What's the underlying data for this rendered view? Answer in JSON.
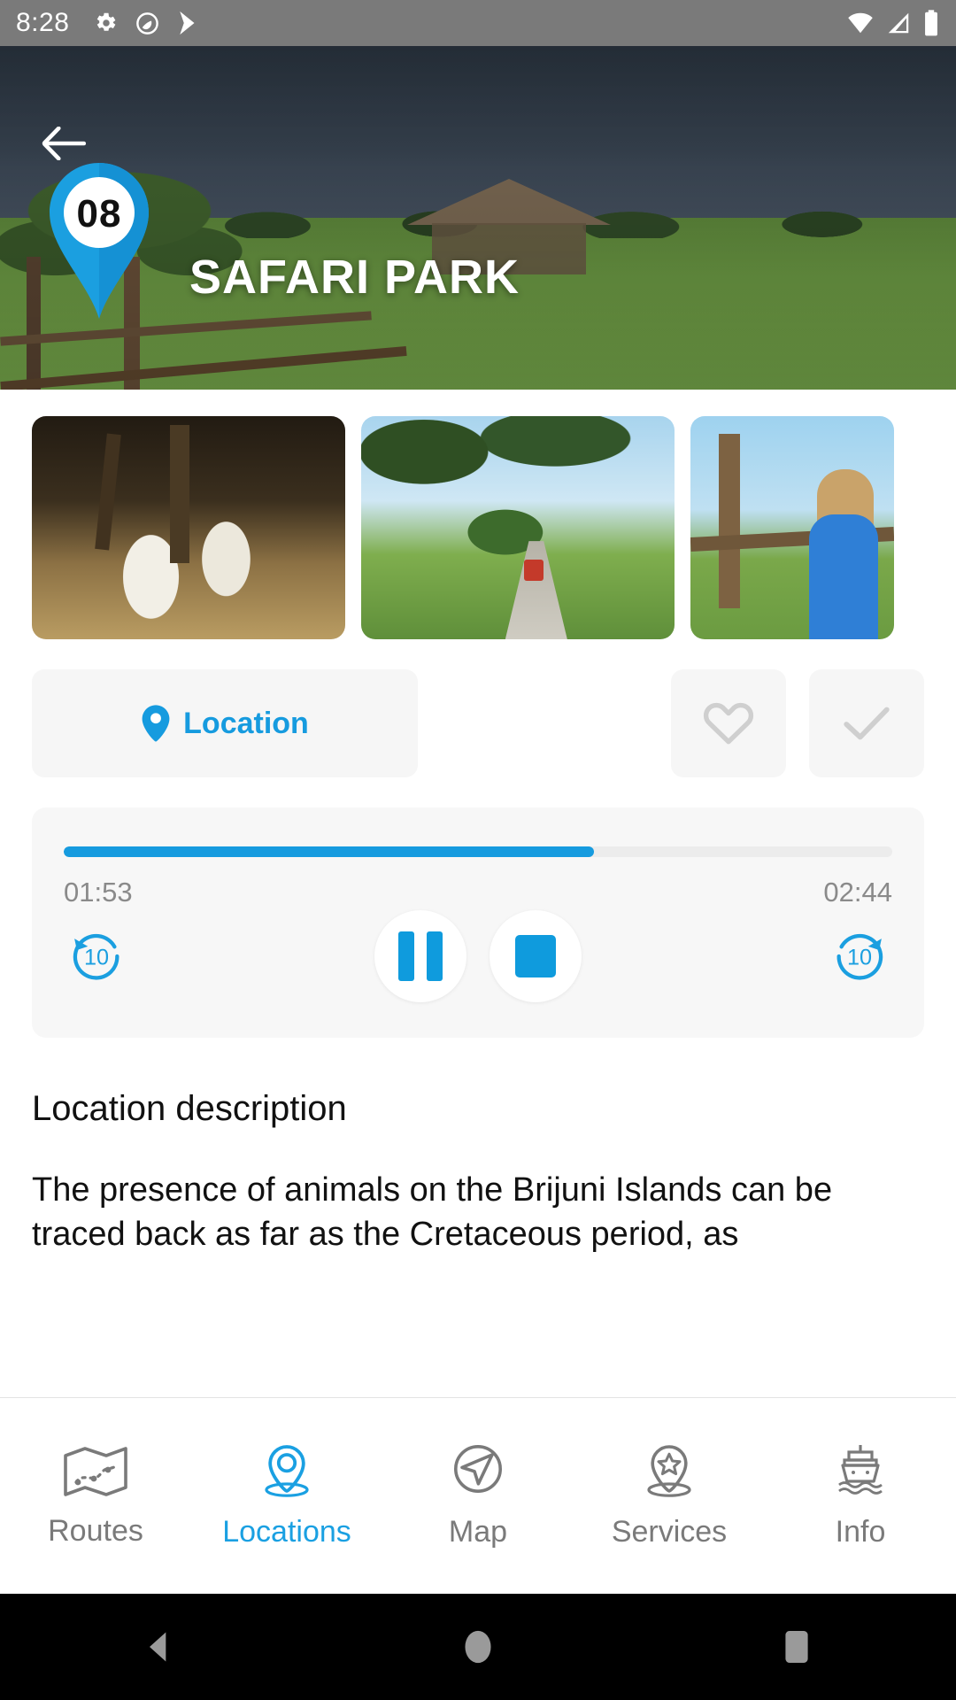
{
  "statusbar": {
    "time": "8:28",
    "icons_left": [
      "gear-icon",
      "do-not-disturb-icon",
      "play-store-icon"
    ],
    "icons_right": [
      "wifi-icon",
      "signal-icon",
      "battery-icon"
    ]
  },
  "hero": {
    "back_icon": "back-arrow-icon",
    "pin_number": "08",
    "title": "SAFARI PARK",
    "accent_color": "#169bdf"
  },
  "gallery": {
    "thumbnails": [
      {
        "alt": "goats feeding at a wooden hay feeder"
      },
      {
        "alt": "tree-lined gravel road with a tourist buggy"
      },
      {
        "alt": "child in blue jacket looking over a wooden fence"
      }
    ]
  },
  "actions": {
    "location_label": "Location",
    "location_icon": "map-pin-icon",
    "favorite_icon": "heart-icon",
    "visited_icon": "check-icon"
  },
  "player": {
    "current_time": "01:53",
    "total_time": "02:44",
    "progress_percent": 64,
    "rewind_label": "10",
    "forward_label": "10",
    "rewind_icon": "replay-10-icon",
    "forward_icon": "forward-10-icon",
    "pause_icon": "pause-icon",
    "stop_icon": "stop-icon",
    "accent_color": "#0f9bdd",
    "track_color": "#ececec"
  },
  "description": {
    "heading": "Location description",
    "body": "The presence of animals on the Brijuni Islands can be traced back as far as the Cretaceous period, as"
  },
  "bottomnav": {
    "active_color": "#1aa0e2",
    "inactive_color": "#7a7a7a",
    "items": [
      {
        "label": "Routes",
        "icon": "folded-map-icon",
        "active": false
      },
      {
        "label": "Locations",
        "icon": "location-pin-icon",
        "active": true
      },
      {
        "label": "Map",
        "icon": "compass-navigation-icon",
        "active": false
      },
      {
        "label": "Services",
        "icon": "star-pin-icon",
        "active": false
      },
      {
        "label": "Info",
        "icon": "ferry-ship-icon",
        "active": false
      }
    ]
  },
  "androidnav": {
    "back": "android-back-icon",
    "home": "android-home-icon",
    "recents": "android-recents-icon"
  }
}
